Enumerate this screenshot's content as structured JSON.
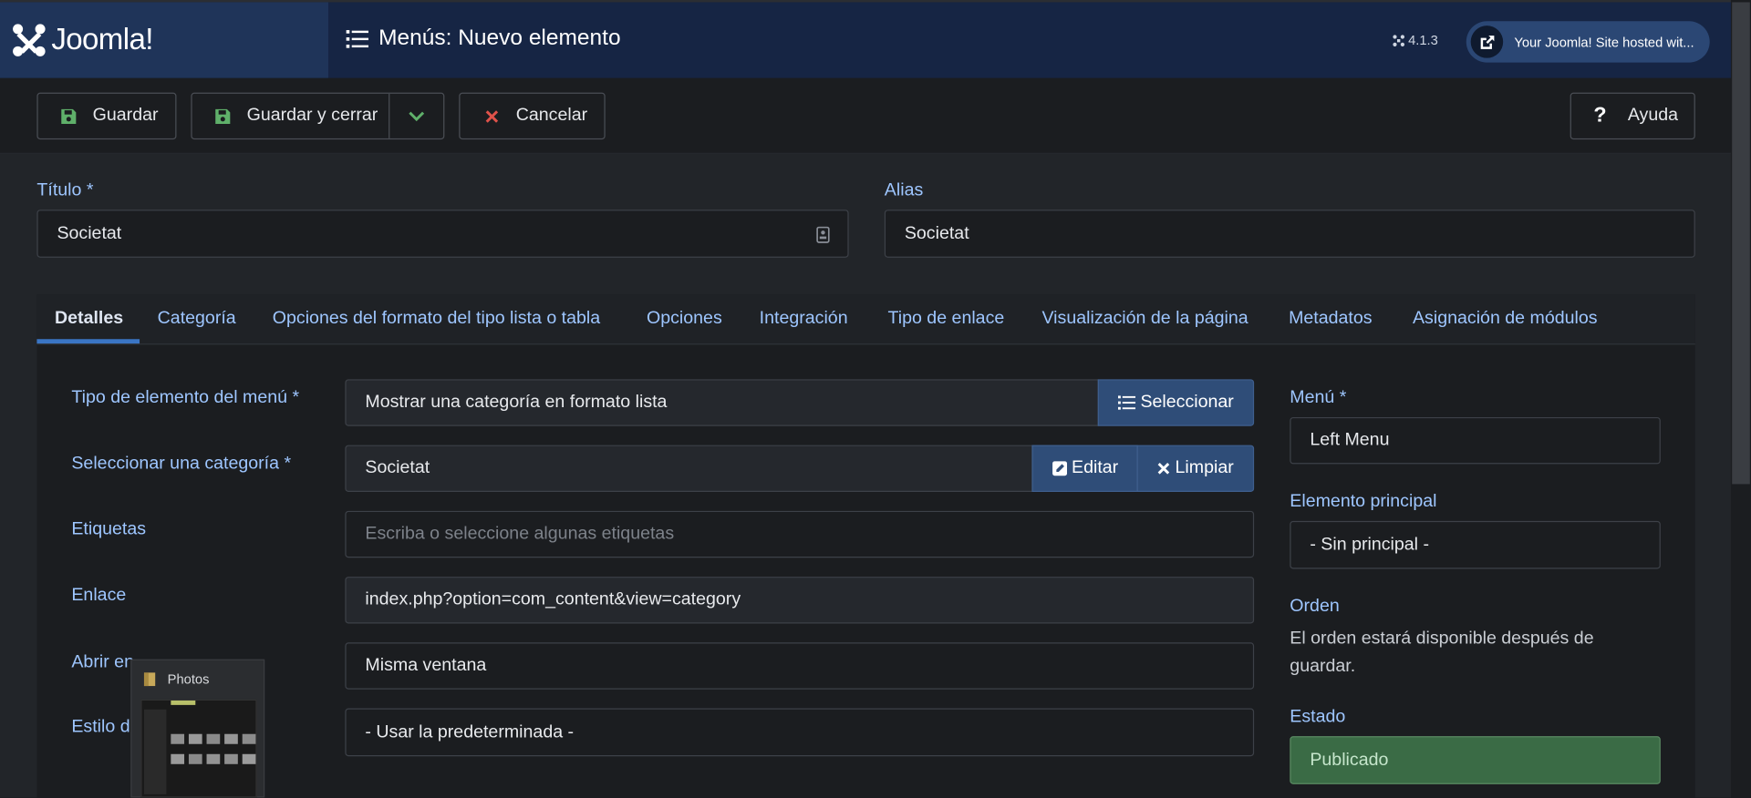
{
  "header": {
    "logo_text": "Joomla!",
    "page_title": "Menús: Nuevo elemento",
    "version": "4.1.3",
    "site_link": "Your Joomla! Site hosted wit..."
  },
  "toolbar": {
    "save_label": "Guardar",
    "save_close_label": "Guardar y cerrar",
    "cancel_label": "Cancelar",
    "help_label": "Ayuda"
  },
  "form": {
    "title_label": "Título *",
    "title_value": "Societat",
    "alias_label": "Alias",
    "alias_value": "Societat"
  },
  "tabs": [
    {
      "label": "Detalles"
    },
    {
      "label": "Categoría"
    },
    {
      "label": "Opciones del formato del tipo lista o tabla"
    },
    {
      "label": "Opciones"
    },
    {
      "label": "Integración"
    },
    {
      "label": "Tipo de enlace"
    },
    {
      "label": "Visualización de la página"
    },
    {
      "label": "Metadatos"
    },
    {
      "label": "Asignación de módulos"
    }
  ],
  "details": {
    "menu_item_type_label": "Tipo de elemento del menú *",
    "menu_item_type_value": "Mostrar una categoría en formato lista",
    "select_button": "Seleccionar",
    "category_label": "Seleccionar una categoría *",
    "category_value": "Societat",
    "edit_button": "Editar",
    "clear_button": "Limpiar",
    "tags_label": "Etiquetas",
    "tags_placeholder": "Escriba o seleccione algunas etiquetas",
    "link_label": "Enlace",
    "link_value": "index.php?option=com_content&view=category",
    "open_in_label": "Abrir en",
    "open_in_value": "Misma ventana",
    "template_style_label": "Estilo de la plantilla",
    "template_style_value": "- Usar la predeterminada -"
  },
  "sidebar": {
    "menu_label": "Menú *",
    "menu_value": "Left Menu",
    "parent_label": "Elemento principal",
    "parent_value": "- Sin principal -",
    "order_label": "Orden",
    "order_text_1": "El orden estará disponible después de",
    "order_text_2": "guardar.",
    "state_label": "Estado",
    "state_value": "Publicado"
  },
  "popup": {
    "title": "Photos"
  },
  "colors": {
    "header_bg": "#162544",
    "accent_blue": "#2f4d78",
    "label_blue": "#9ec6ff",
    "published_green": "#3a6b45",
    "save_icon_green": "#5fb06a",
    "cancel_icon_red": "#e0524a"
  }
}
